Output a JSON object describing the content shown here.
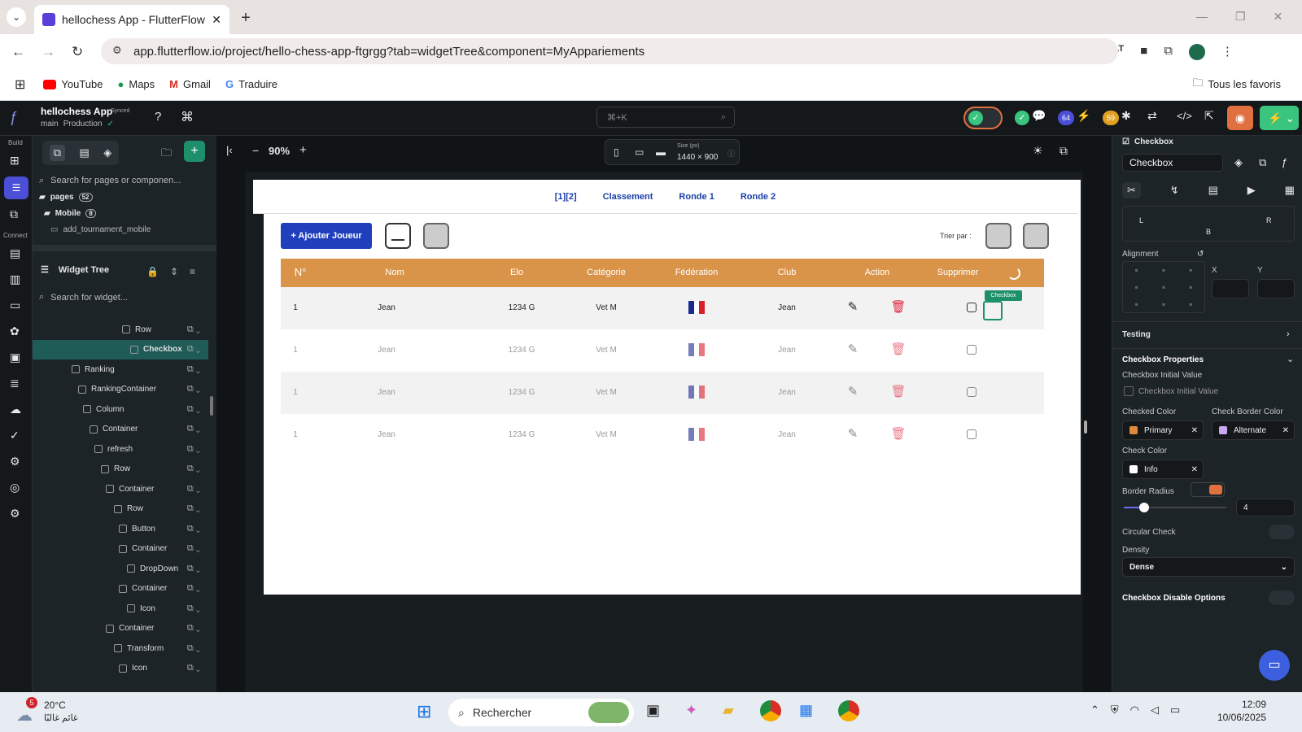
{
  "browser": {
    "tab_title": "hellochess App - FlutterFlow",
    "url": "app.flutterflow.io/project/hello-chess-app-ftgrgg?tab=widgetTree&component=MyAppariements",
    "bookmarks": [
      "YouTube",
      "Maps",
      "Gmail",
      "Traduire"
    ],
    "all_bookmarks": "Tous les favoris"
  },
  "ff": {
    "app_name": "hellochess App",
    "synced": "Synced",
    "branch": "main",
    "env": "Production",
    "search_hint": "⌘+K",
    "badge_64": "64",
    "badge_59": "59",
    "rail_build": "Build",
    "rail_connect": "Connect"
  },
  "left_panel": {
    "search_pages": "Search for pages or componen...",
    "pages_label": "pages",
    "pages_count": "52",
    "mobile_label": "Mobile",
    "mobile_count": "8",
    "page_item": "add_tournament_mobile",
    "widget_tree": "Widget Tree",
    "search_widget": "Search for widget...",
    "tree": [
      {
        "label": "Row",
        "indent": 150
      },
      {
        "label": "Checkbox",
        "indent": 160,
        "selected": true
      },
      {
        "label": "Ranking",
        "indent": 88
      },
      {
        "label": "RankingContainer",
        "indent": 96
      },
      {
        "label": "Column",
        "indent": 102
      },
      {
        "label": "Container",
        "indent": 110
      },
      {
        "label": "refresh",
        "indent": 116
      },
      {
        "label": "Row",
        "indent": 124
      },
      {
        "label": "Container",
        "indent": 130
      },
      {
        "label": "Row",
        "indent": 140
      },
      {
        "label": "Button",
        "indent": 146
      },
      {
        "label": "Container",
        "indent": 146
      },
      {
        "label": "DropDown",
        "indent": 156
      },
      {
        "label": "Container",
        "indent": 146
      },
      {
        "label": "Icon",
        "indent": 156
      },
      {
        "label": "Container",
        "indent": 130
      },
      {
        "label": "Transform",
        "indent": 140
      },
      {
        "label": "Icon",
        "indent": 146
      }
    ]
  },
  "canvas": {
    "zoom": "90%",
    "size_label": "Size (px)",
    "size_value": "1440 × 900"
  },
  "app_page": {
    "nav": [
      "[1][2]",
      "Classement",
      "Ronde 1",
      "Ronde 2"
    ],
    "add_button": "+ Ajouter Joueur",
    "sort_label": "Trier par :",
    "columns": [
      "N°",
      "Nom",
      "Elo",
      "Catégorie",
      "Fédération",
      "Club",
      "Action",
      "Supprimer"
    ],
    "rows": [
      {
        "n": "1",
        "nom": "Jean",
        "elo": "1234 G",
        "cat": "Vet M",
        "club": "Jean"
      },
      {
        "n": "1",
        "nom": "Jean",
        "elo": "1234 G",
        "cat": "Vet M",
        "club": "Jean"
      },
      {
        "n": "1",
        "nom": "Jean",
        "elo": "1234 G",
        "cat": "Vet M",
        "club": "Jean"
      },
      {
        "n": "1",
        "nom": "Jean",
        "elo": "1234 G",
        "cat": "Vet M",
        "club": "Jean"
      }
    ],
    "checkbox_tag": "Checkbox"
  },
  "right_panel": {
    "widget_type": "Checkbox",
    "widget_name": "Checkbox",
    "pad_l": "L",
    "pad_r": "R",
    "pad_b": "B",
    "alignment": "Alignment",
    "x": "X",
    "y": "Y",
    "testing": "Testing",
    "props_title": "Checkbox Properties",
    "initial_value": "Checkbox Initial Value",
    "initial_value_cb": "Checkbox Initial Value",
    "checked_color": "Checked Color",
    "checked_color_val": "Primary",
    "check_border_color": "Check Border Color",
    "check_border_val": "Alternate",
    "check_color": "Check Color",
    "check_color_val": "Info",
    "border_radius": "Border Radius",
    "border_radius_val": "4",
    "border_radius_fraction": 0.2,
    "circular_check": "Circular Check",
    "density": "Density",
    "density_val": "Dense",
    "disable_options": "Checkbox Disable Options"
  },
  "taskbar": {
    "weather_temp": "20°C",
    "weather_text": "غائم غالبًا",
    "weather_badge": "5",
    "search": "Rechercher",
    "time": "12:09",
    "date": "10/06/2025"
  },
  "colors": {
    "header_orange": "#d9944a",
    "primary_blue": "#1f3fbd",
    "ff_selected": "#1f5b57",
    "delete_red": "#e0223a"
  }
}
